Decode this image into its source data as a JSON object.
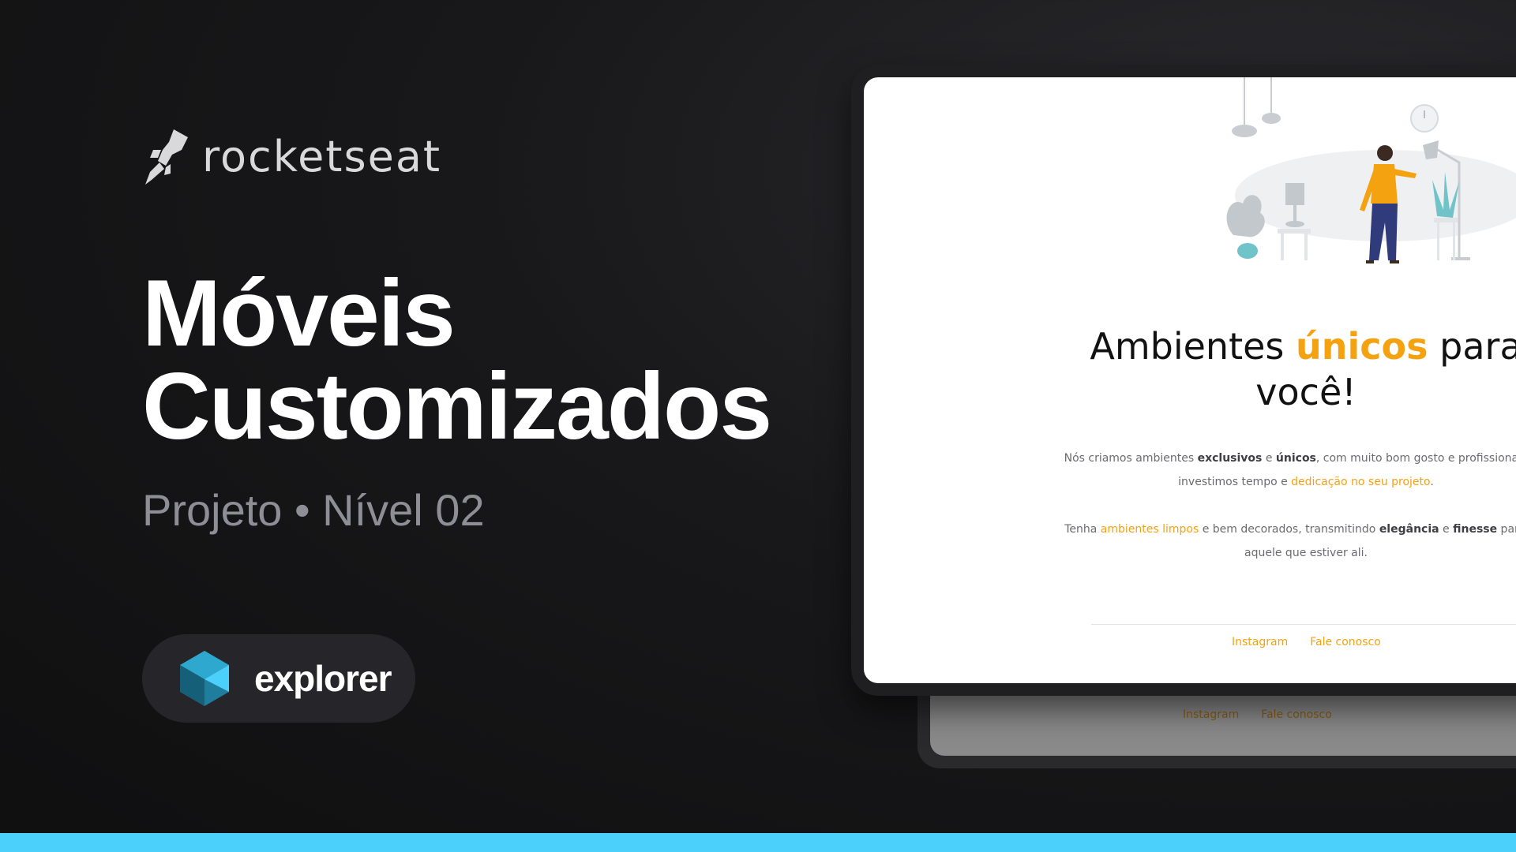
{
  "brand": {
    "name": "rocketseat",
    "icon": "rocket-icon"
  },
  "title": {
    "line1": "Móveis",
    "line2": "Customizados"
  },
  "subtitle": "Projeto • Nível 02",
  "badge": {
    "label": "explorer",
    "icon": "explorer-hexagon-icon"
  },
  "preview": {
    "heading_start": "Ambientes ",
    "heading_accent": "únicos",
    "heading_end": " para",
    "heading_line2": "você!",
    "p1": {
      "t1": "Nós criamos ambientes ",
      "b1": "exclusivos",
      "t2": " e ",
      "b2": "únicos",
      "t3": ", com muito bom gosto e profissionalismo",
      "t4": "investimos tempo e ",
      "h1": "dedicação no seu projeto",
      "t5": "."
    },
    "p2": {
      "t1": "Tenha ",
      "h1": "ambientes limpos",
      "t2": " e bem decorados, transmitindo ",
      "b1": "elegância",
      "t3": "  e ",
      "b2": "finesse",
      "t4": " para tod",
      "t5": "aquele que estiver ali."
    },
    "footer_links": [
      "Instagram",
      "Fale conosco"
    ],
    "back_links": [
      "Instagram",
      "Fale conosco"
    ]
  },
  "colors": {
    "accent": "#f5a211",
    "bar": "#4bd0fb",
    "badge_bg": "#26262a"
  }
}
